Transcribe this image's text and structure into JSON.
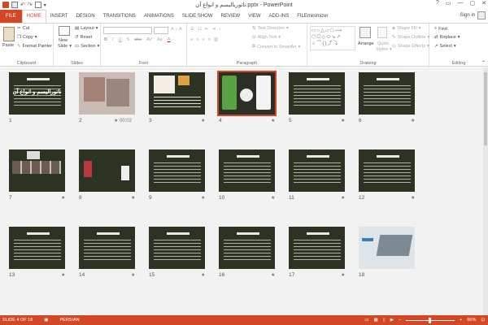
{
  "window": {
    "title": "ناتوریالیسم و انواع آن.pptx - PowerPoint",
    "controls": [
      "?",
      "▭",
      "—",
      "▢",
      "✕"
    ]
  },
  "tabs": [
    "FILE",
    "HOME",
    "INSERT",
    "DESIGN",
    "TRANSITIONS",
    "ANIMATIONS",
    "SLIDE SHOW",
    "REVIEW",
    "VIEW",
    "ADD-INS",
    "FILEminimizer"
  ],
  "active_tab": "HOME",
  "account": {
    "signin": "Sign in"
  },
  "ribbon": {
    "clipboard": {
      "paste": "Paste",
      "cut": "Cut",
      "copy": "Copy",
      "format_painter": "Format Painter",
      "label": "Clipboard"
    },
    "slides": {
      "new_slide": "New",
      "new_slide2": "Slide",
      "layout": "Layout",
      "reset": "Reset",
      "section": "Section",
      "label": "Slides"
    },
    "font": {
      "label": "Font"
    },
    "paragraph": {
      "text_direction": "Text Direction",
      "align_text": "Align Text",
      "convert": "Convert to SmartArt",
      "label": "Paragraph"
    },
    "drawing": {
      "arrange": "Arrange",
      "quick_styles": "Quick",
      "quick_styles2": "Styles",
      "shape_fill": "Shape Fill",
      "shape_outline": "Shape Outline",
      "shape_effects": "Shape Effects",
      "label": "Drawing"
    },
    "editing": {
      "find": "Find",
      "replace": "Replace",
      "select": "Select",
      "label": "Editing"
    }
  },
  "slides": [
    {
      "num": "1",
      "title": "ناتورالیسم و انواع آن",
      "star": ""
    },
    {
      "num": "2",
      "title": "",
      "star": "★ 00:02"
    },
    {
      "num": "3",
      "title": "",
      "star": "★"
    },
    {
      "num": "4",
      "title": "",
      "star": "★"
    },
    {
      "num": "5",
      "title": "",
      "star": "★"
    },
    {
      "num": "6",
      "title": "",
      "star": "★"
    },
    {
      "num": "7",
      "title": "",
      "star": "★"
    },
    {
      "num": "8",
      "title": "",
      "star": "★"
    },
    {
      "num": "9",
      "title": "",
      "star": "★"
    },
    {
      "num": "10",
      "title": "",
      "star": "★"
    },
    {
      "num": "11",
      "title": "",
      "star": "★"
    },
    {
      "num": "12",
      "title": "",
      "star": "★"
    },
    {
      "num": "13",
      "title": "",
      "star": "★"
    },
    {
      "num": "14",
      "title": "",
      "star": "★"
    },
    {
      "num": "15",
      "title": "",
      "star": "★"
    },
    {
      "num": "16",
      "title": "",
      "star": "★"
    },
    {
      "num": "17",
      "title": "",
      "star": "★"
    },
    {
      "num": "18",
      "title": "",
      "star": ""
    }
  ],
  "status": {
    "slide_of": "SLIDE 4 OF 18",
    "language": "PERSIAN",
    "zoom": "66%"
  }
}
